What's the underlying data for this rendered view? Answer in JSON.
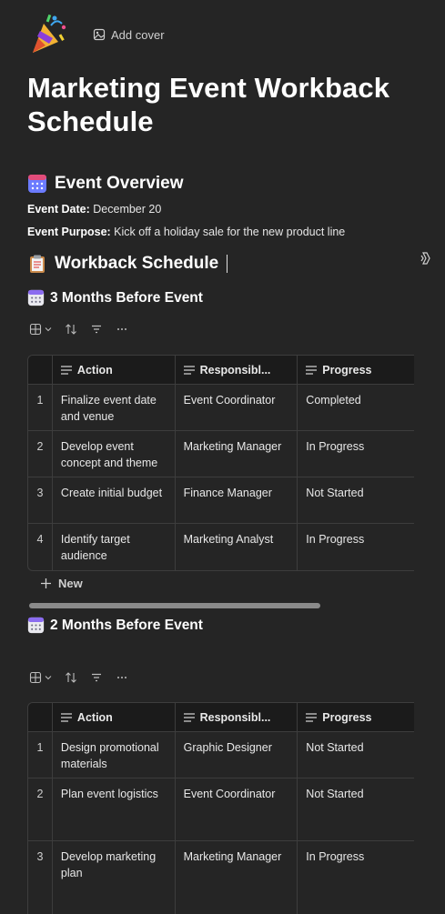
{
  "header": {
    "icon": "party-popper-icon",
    "add_cover_label": "Add cover"
  },
  "page": {
    "title": "Marketing Event Workback Schedule"
  },
  "overview": {
    "heading": "Event Overview",
    "date_label": "Event Date:",
    "date_value": "December 20",
    "purpose_label": "Event Purpose:",
    "purpose_value": "Kick off a holiday sale for the new product line"
  },
  "workback": {
    "heading": "Workback Schedule"
  },
  "columns": {
    "action": "Action",
    "responsible": "Responsibl...",
    "progress": "Progress"
  },
  "section1": {
    "heading": "3 Months Before Event",
    "rows": [
      {
        "num": "1",
        "action": "Finalize event date and venue",
        "responsible": "Event Coordinator",
        "progress": "Completed"
      },
      {
        "num": "2",
        "action": "Develop event concept and theme",
        "responsible": "Marketing Manager",
        "progress": "In Progress"
      },
      {
        "num": "3",
        "action": "Create initial budget",
        "responsible": "Finance Manager",
        "progress": "Not Started"
      },
      {
        "num": "4",
        "action": "Identify target audience",
        "responsible": "Marketing Analyst",
        "progress": "In Progress"
      }
    ],
    "new_label": "New"
  },
  "section2": {
    "heading": "2 Months Before Event",
    "rows": [
      {
        "num": "1",
        "action": "Design promotional materials",
        "responsible": "Graphic Designer",
        "progress": "Not Started"
      },
      {
        "num": "2",
        "action": "Plan event logistics",
        "responsible": "Event Coordinator",
        "progress": "Not Started"
      },
      {
        "num": "3",
        "action": "Develop marketing plan",
        "responsible": "Marketing Manager",
        "progress": "In Progress"
      }
    ]
  },
  "colors": {
    "background": "#252525",
    "header_row": "#1b1b1b",
    "border": "#3d3d3d",
    "text": "#ffffff"
  }
}
